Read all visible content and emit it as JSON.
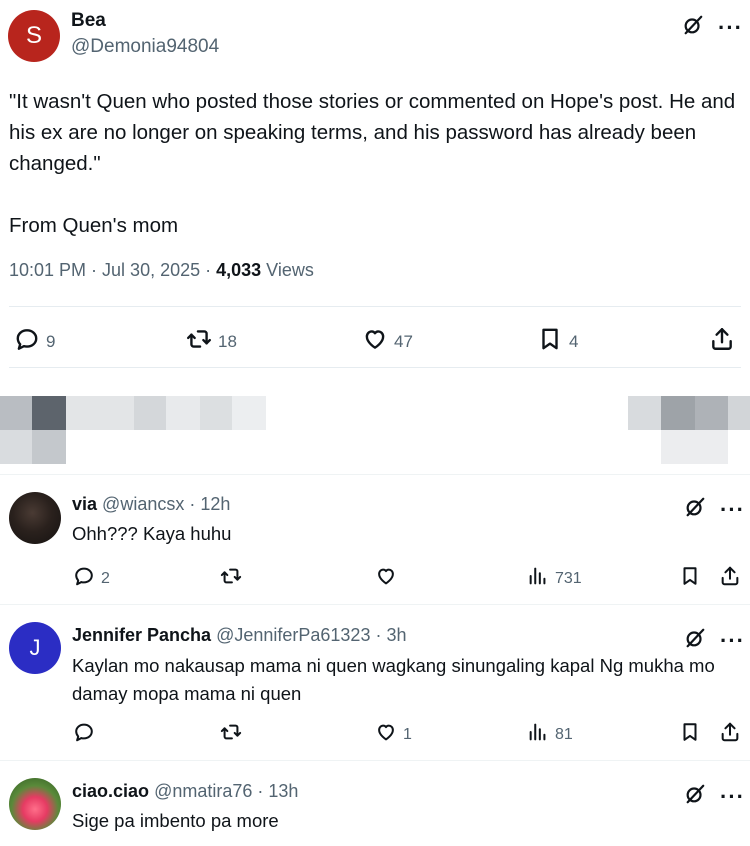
{
  "post": {
    "author_initial": "S",
    "author_name": "Bea",
    "author_handle": "@Demonia94804",
    "text": "\"It wasn't Quen who posted those stories or commented on Hope's post. He and his ex are no longer on speaking terms, and his password has already been changed.\"\n\nFrom Quen's mom",
    "time": "10:01 PM · Jul 30, 2025 · ",
    "views_count": "4,033",
    "views_label": " Views",
    "counts": {
      "replies": "9",
      "reposts": "18",
      "likes": "47",
      "bookmarks": "4"
    }
  },
  "replies": [
    {
      "name": "via",
      "handle": "@wiancsx · 12h",
      "text": "Ohh??? Kaya huhu",
      "counts": {
        "replies": "2",
        "reposts": "",
        "likes": "",
        "views": "731"
      }
    },
    {
      "initial": "J",
      "name": "Jennifer Pancha",
      "handle": "@JenniferPa61323 · 3h",
      "text": "Kaylan mo nakausap mama ni quen wagkang sinungaling kapal Ng mukha mo damay mopa mama ni quen",
      "counts": {
        "replies": "",
        "reposts": "",
        "likes": "1",
        "views": "81"
      }
    },
    {
      "name": "ciao.ciao",
      "handle": "@nmatira76 · 13h",
      "text": "Sige pa imbento pa more"
    }
  ],
  "icons": {
    "grok": "grok-icon",
    "more": "more-icon",
    "reply": "reply-icon",
    "repost": "repost-icon",
    "like": "like-icon",
    "bookmark": "bookmark-icon",
    "share": "share-icon",
    "views": "views-icon"
  },
  "colors": {
    "avatar_s": "#b8251d",
    "avatar_j": "#2b2dc4",
    "text": "#0f1419",
    "muted": "#536471"
  },
  "more_glyph": "···"
}
